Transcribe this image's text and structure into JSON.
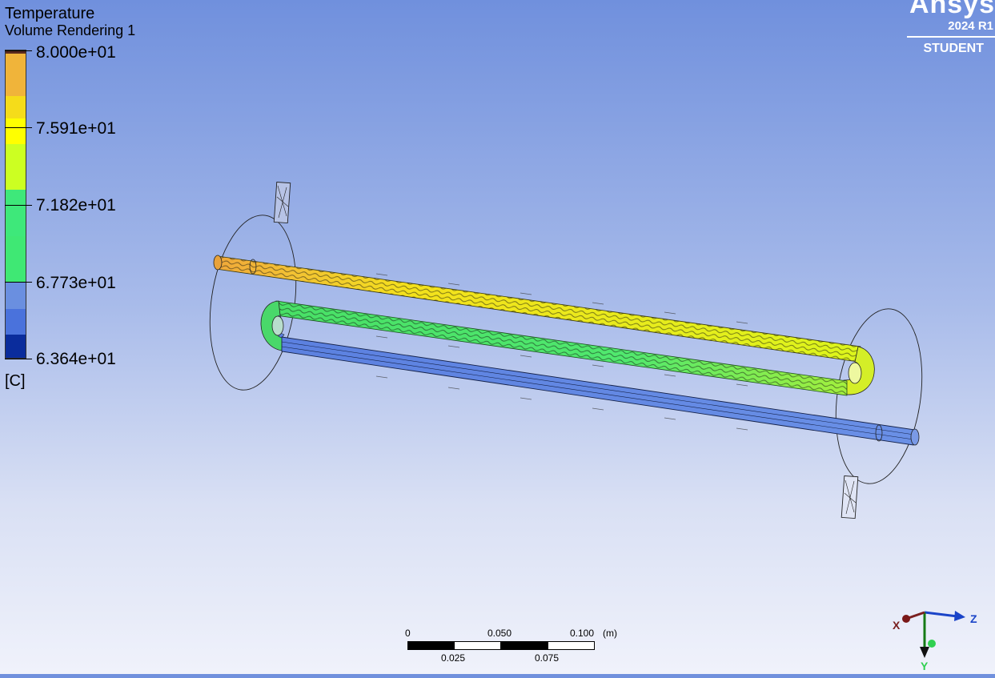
{
  "legend": {
    "title": "Temperature",
    "subtitle": "Volume Rendering 1",
    "values": [
      "8.000e+01",
      "7.591e+01",
      "7.182e+01",
      "6.773e+01",
      "6.364e+01"
    ],
    "unit": "[C]",
    "colors": [
      "#5a2a1e",
      "#f0b43a",
      "#f5dc1a",
      "#ffff00",
      "#ccff22",
      "#3ee87a",
      "#3fe874",
      "#6a8fe0",
      "#4a72dc",
      "#0a2c9c"
    ]
  },
  "brand": {
    "name": "Ansys",
    "version": "2024 R1",
    "edition": "STUDENT"
  },
  "scale_bar": {
    "top_labels": [
      "0",
      "0.050",
      "0.100"
    ],
    "unit": "(m)",
    "bottom_labels": [
      "0.025",
      "0.075"
    ]
  },
  "axes": {
    "x": "X",
    "y": "Y",
    "z": "Z"
  }
}
